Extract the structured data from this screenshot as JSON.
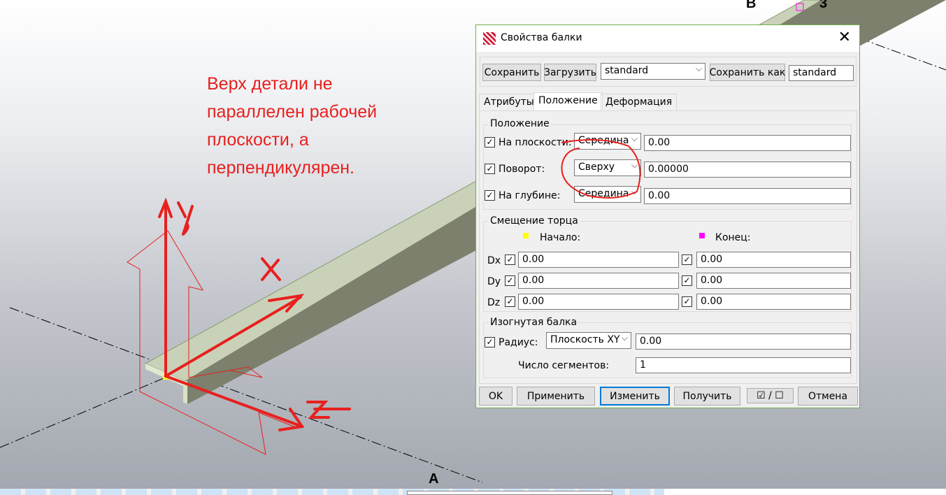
{
  "annotation": {
    "text": "Верх детали не\nпараллелен рабочей\nплоскости, а\nперпендикулярен.",
    "axis_labels": [
      "y",
      "X",
      "Z"
    ]
  },
  "scene": {
    "grid_labels": [
      "B",
      "3",
      "A"
    ]
  },
  "dialog": {
    "title": "Свойства балки",
    "close_icon": "close-icon",
    "toolbar": {
      "save": "Сохранить",
      "load": "Загрузить",
      "preset": "standard",
      "save_as": "Сохранить как",
      "save_as_name": "standard"
    },
    "tabs": [
      "Атрибуты",
      "Положение",
      "Деформация"
    ],
    "position": {
      "title": "Положение",
      "rows": [
        {
          "label": "На плоскости:",
          "option": "Середина",
          "value": "0.00",
          "checked": true
        },
        {
          "label": "Поворот:",
          "option": "Сверху",
          "value": "0.00000",
          "checked": true
        },
        {
          "label": "На глубине:",
          "option": "Середина",
          "value": "0.00",
          "checked": true
        }
      ]
    },
    "end_offset": {
      "title": "Смещение торца",
      "start": "Начало:",
      "end": "Конец:",
      "start_color": "#ffff00",
      "end_color": "#ff00ff",
      "rows": [
        {
          "label": "Dx",
          "start": "0.00",
          "end": "0.00"
        },
        {
          "label": "Dy",
          "start": "0.00",
          "end": "0.00"
        },
        {
          "label": "Dz",
          "start": "0.00",
          "end": "0.00"
        }
      ]
    },
    "curved": {
      "title": "Изогнутая балка",
      "radius_label": "Радиус:",
      "plane": "Плоскость XY",
      "radius": "0.00",
      "segments_label": "Число сегментов:",
      "segments": "1"
    },
    "footer": {
      "ok": "OK",
      "apply": "Применить",
      "modify": "Изменить",
      "get": "Получить",
      "toggle": "☑ / ☐",
      "cancel": "Отмена"
    }
  }
}
